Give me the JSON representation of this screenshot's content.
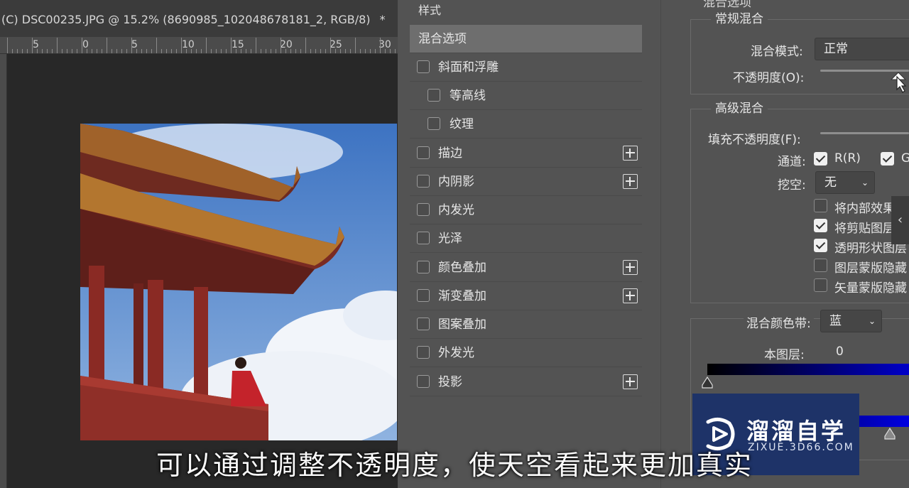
{
  "document": {
    "tab_title": "(C) DSC00235.JPG @ 15.2% (8690985_102048678181_2, RGB/8)",
    "close": "*"
  },
  "ruler": {
    "labels": [
      "5",
      "0",
      "5",
      "10",
      "15",
      "20",
      "25",
      "30"
    ]
  },
  "styles_panel": {
    "header": "样式",
    "items": [
      {
        "label": "混合选项",
        "selected": true
      },
      {
        "label": "斜面和浮雕",
        "checkbox": true
      },
      {
        "label": "等高线",
        "checkbox": true,
        "sub": true
      },
      {
        "label": "纹理",
        "checkbox": true,
        "sub": true
      },
      {
        "label": "描边",
        "checkbox": true,
        "plus": true
      },
      {
        "label": "内阴影",
        "checkbox": true,
        "plus": true
      },
      {
        "label": "内发光",
        "checkbox": true
      },
      {
        "label": "光泽",
        "checkbox": true
      },
      {
        "label": "颜色叠加",
        "checkbox": true,
        "plus": true
      },
      {
        "label": "渐变叠加",
        "checkbox": true,
        "plus": true
      },
      {
        "label": "图案叠加",
        "checkbox": true
      },
      {
        "label": "外发光",
        "checkbox": true
      },
      {
        "label": "投影",
        "checkbox": true,
        "plus": true
      }
    ]
  },
  "blend_options": {
    "top_title": "混合选项",
    "general": {
      "title": "常规混合",
      "mode_label": "混合模式:",
      "mode_value": "正常",
      "opacity_label": "不透明度(O):"
    },
    "advanced": {
      "title": "高级混合",
      "fill_label": "填充不透明度(F):",
      "channels_label": "通道:",
      "channel_r": "R(R)",
      "channel_g": "G",
      "knockout_label": "挖空:",
      "knockout_value": "无",
      "options": [
        {
          "label": "将内部效果混",
          "checked": false
        },
        {
          "label": "将剪贴图层",
          "checked": true
        },
        {
          "label": "透明形状图层",
          "checked": true
        },
        {
          "label": "图层蒙版隐藏",
          "checked": false
        },
        {
          "label": "矢量蒙版隐藏",
          "checked": false
        }
      ]
    },
    "blend_if": {
      "label": "混合颜色带:",
      "value": "蓝",
      "this_layer_label": "本图层:",
      "this_layer_value": "0"
    }
  },
  "watermark": {
    "brand": "溜溜自学",
    "site": "ZIXUE.3D66.COM"
  },
  "caption": "可以通过调整不透明度，使天空看起来更加真实",
  "colors": {
    "panel": "#535353",
    "selected": "#6e6e6e",
    "logo_bg": "#1e3368",
    "gradient_blue": "#0000c8"
  }
}
